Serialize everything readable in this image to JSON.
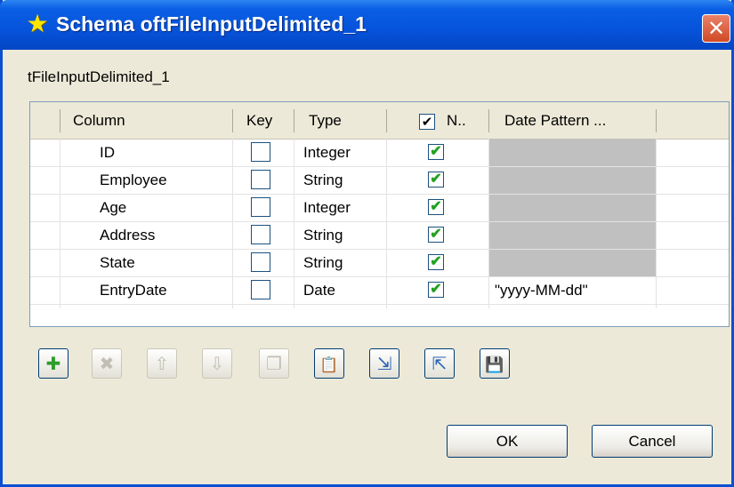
{
  "window": {
    "title": "Schema oftFileInputDelimited_1",
    "close_label": "✕"
  },
  "component_label": "tFileInputDelimited_1",
  "table": {
    "headers": [
      "Column",
      "Key",
      "Type",
      "N..",
      "Date Pattern ..."
    ],
    "header_nullable_checked": "✔",
    "rows": [
      {
        "column": "ID",
        "key": false,
        "type": "Integer",
        "nullable": true,
        "date_pattern": ""
      },
      {
        "column": "Employee",
        "key": false,
        "type": "String",
        "nullable": true,
        "date_pattern": ""
      },
      {
        "column": "Age",
        "key": false,
        "type": "Integer",
        "nullable": true,
        "date_pattern": ""
      },
      {
        "column": "Address",
        "key": false,
        "type": "String",
        "nullable": true,
        "date_pattern": ""
      },
      {
        "column": "State",
        "key": false,
        "type": "String",
        "nullable": true,
        "date_pattern": ""
      },
      {
        "column": "EntryDate",
        "key": false,
        "type": "Date",
        "nullable": true,
        "date_pattern": "\"yyyy-MM-dd\""
      }
    ]
  },
  "toolbar": {
    "buttons": [
      {
        "name": "add-icon",
        "glyph": "✚",
        "enabled": true,
        "color": "#2e9d2e"
      },
      {
        "name": "delete-icon",
        "glyph": "✖",
        "enabled": false,
        "color": "#b8b6aa"
      },
      {
        "name": "move-up-icon",
        "glyph": "⇧",
        "enabled": false,
        "color": "#b8b6aa"
      },
      {
        "name": "move-down-icon",
        "glyph": "⇩",
        "enabled": false,
        "color": "#b8b6aa"
      },
      {
        "name": "copy-icon",
        "glyph": "❐",
        "enabled": false,
        "color": "#b8b6aa"
      },
      {
        "name": "paste-icon",
        "glyph": "📋",
        "enabled": true,
        "color": "#a07020"
      },
      {
        "name": "import-icon",
        "glyph": "⇲",
        "enabled": true,
        "color": "#2a63b8"
      },
      {
        "name": "export-icon",
        "glyph": "⇱",
        "enabled": true,
        "color": "#2a63b8"
      },
      {
        "name": "save-icon",
        "glyph": "💾",
        "enabled": true,
        "color": "#2a3fa0"
      }
    ]
  },
  "buttons": {
    "ok": "OK",
    "cancel": "Cancel"
  },
  "check_glyph": "✔"
}
